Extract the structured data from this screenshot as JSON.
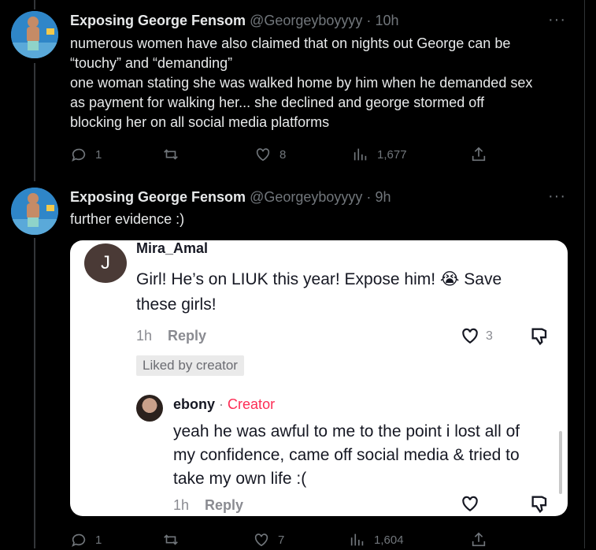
{
  "tweets": [
    {
      "name": "Exposing George Fensom",
      "handle": "@Georgeyboyyyy",
      "sep": "·",
      "time": "10h",
      "more": "···",
      "lines": [
        "numerous women have also claimed that on nights out George can be",
        "“touchy” and “demanding”",
        "one woman stating she was walked home by him when he demanded sex",
        "as payment for walking her... she declined and george stormed off",
        "blocking her on all social media platforms"
      ],
      "replies": "1",
      "retweets": "",
      "likes": "8",
      "views": "1,677"
    },
    {
      "name": "Exposing George Fensom",
      "handle": "@Georgeyboyyyy",
      "sep": "·",
      "time": "9h",
      "more": "···",
      "lines": [
        "further evidence :)"
      ],
      "replies": "1",
      "retweets": "",
      "likes": "7",
      "views": "1,604"
    }
  ],
  "embed": {
    "comment": {
      "avatar_letter": "J",
      "user": "Mira_Amal",
      "text_line1": "Girl! He’s on LIUK this year! Expose him! 😭 Save",
      "text_line2": "these girls!",
      "time": "1h",
      "reply": "Reply",
      "likes": "3",
      "liked_badge": "Liked by creator"
    },
    "reply": {
      "user": "ebony",
      "sep": "·",
      "creator": "Creator",
      "line1": "yeah he was awful to me to the point i lost all of",
      "line2": "my confidence, came off social media & tried to",
      "line3": "take my own life :(",
      "time": "1h",
      "reply": "Reply"
    }
  }
}
